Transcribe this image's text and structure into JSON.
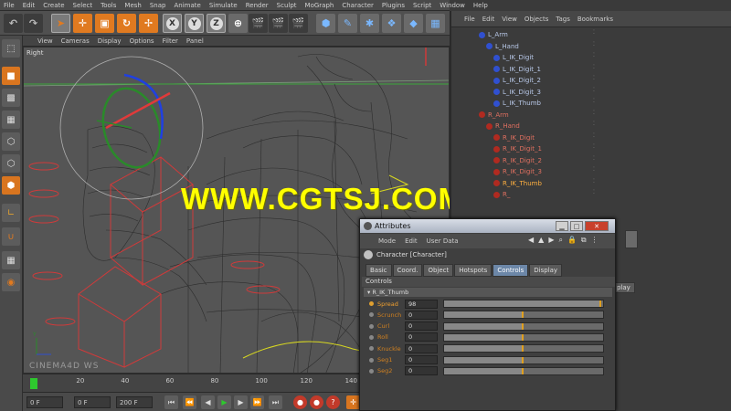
{
  "menubar": [
    "File",
    "Edit",
    "Create",
    "Select",
    "Tools",
    "Mesh",
    "Snap",
    "Animate",
    "Simulate",
    "Render",
    "Sculpt",
    "MoGraph",
    "Character",
    "Plugins",
    "Script",
    "Window",
    "Help"
  ],
  "viewport_menu": [
    "View",
    "Cameras",
    "Display",
    "Options",
    "Filter",
    "Panel"
  ],
  "viewport_name": "Right",
  "viewport_logo": "CINEMA4D WS",
  "watermark": "WWW.CGTSJ.COM",
  "toolbar": {
    "x_label": "X",
    "y_label": "Y",
    "z_label": "Z"
  },
  "timeline": {
    "ticks": [
      {
        "value": "0",
        "pos": 0.02
      },
      {
        "value": "20",
        "pos": 0.125
      },
      {
        "value": "40",
        "pos": 0.23
      },
      {
        "value": "60",
        "pos": 0.335
      },
      {
        "value": "80",
        "pos": 0.44
      },
      {
        "value": "100",
        "pos": 0.545
      },
      {
        "value": "120",
        "pos": 0.65
      },
      {
        "value": "140",
        "pos": 0.755
      },
      {
        "value": "160",
        "pos": 0.86
      }
    ],
    "start_field": "0 F",
    "current_field": "0 F",
    "end_field": "200 F"
  },
  "object_manager": {
    "menu": [
      "File",
      "Edit",
      "View",
      "Objects",
      "Tags",
      "Bookmarks"
    ],
    "tree": [
      {
        "label": "L_Arm",
        "indent": 0,
        "color": "blue",
        "state": "normal"
      },
      {
        "label": "L_Hand",
        "indent": 1,
        "color": "blue",
        "state": "normal"
      },
      {
        "label": "L_IK_Digit",
        "indent": 2,
        "color": "blue",
        "state": "normal"
      },
      {
        "label": "L_IK_Digit_1",
        "indent": 2,
        "color": "blue",
        "state": "normal"
      },
      {
        "label": "L_IK_Digit_2",
        "indent": 2,
        "color": "blue",
        "state": "normal"
      },
      {
        "label": "L_IK_Digit_3",
        "indent": 2,
        "color": "blue",
        "state": "normal"
      },
      {
        "label": "L_IK_Thumb",
        "indent": 2,
        "color": "blue",
        "state": "normal"
      },
      {
        "label": "R_Arm",
        "indent": 0,
        "color": "red",
        "state": "normal"
      },
      {
        "label": "R_Hand",
        "indent": 1,
        "color": "red",
        "state": "normal"
      },
      {
        "label": "R_IK_Digit",
        "indent": 2,
        "color": "red",
        "state": "normal"
      },
      {
        "label": "R_IK_Digit_1",
        "indent": 2,
        "color": "red",
        "state": "normal"
      },
      {
        "label": "R_IK_Digit_2",
        "indent": 2,
        "color": "red",
        "state": "normal"
      },
      {
        "label": "R_IK_Digit_3",
        "indent": 2,
        "color": "red",
        "state": "normal"
      },
      {
        "label": "R_IK_Thumb",
        "indent": 2,
        "color": "red",
        "state": "selected"
      },
      {
        "label": "R_",
        "indent": 2,
        "color": "red",
        "state": "normal"
      }
    ],
    "side_button": "play"
  },
  "attributes": {
    "title": "Attributes",
    "menu": [
      "Mode",
      "Edit",
      "User Data"
    ],
    "object": "Character [Character]",
    "tabs": [
      "Basic",
      "Coord.",
      "Object",
      "Hotspots",
      "Controls",
      "Display"
    ],
    "active_tab": "Controls",
    "section": "Controls",
    "group": "R_IK_Thumb",
    "params": [
      {
        "label": "Spread",
        "value": "98",
        "fill": 0.99,
        "mark": 0.99,
        "active": true
      },
      {
        "label": "Scrunch",
        "value": "0",
        "fill": 0.5,
        "mark": 0.5,
        "active": false
      },
      {
        "label": "Curl",
        "value": "0",
        "fill": 0.5,
        "mark": 0.5,
        "active": false
      },
      {
        "label": "Roll",
        "value": "0",
        "fill": 0.5,
        "mark": 0.5,
        "active": false
      },
      {
        "label": "Knuckle",
        "value": "0",
        "fill": 0.5,
        "mark": 0.5,
        "active": false
      },
      {
        "label": "Seg1",
        "value": "0",
        "fill": 0.5,
        "mark": 0.5,
        "active": false
      },
      {
        "label": "Seg2",
        "value": "0",
        "fill": 0.5,
        "mark": 0.5,
        "active": false
      }
    ]
  },
  "colors": {
    "accent": "#e07a20",
    "selected_tab": "#6c87a8",
    "watermark": "#ffff00",
    "bone_blue": "#3050d0",
    "bone_red": "#b02a20"
  }
}
